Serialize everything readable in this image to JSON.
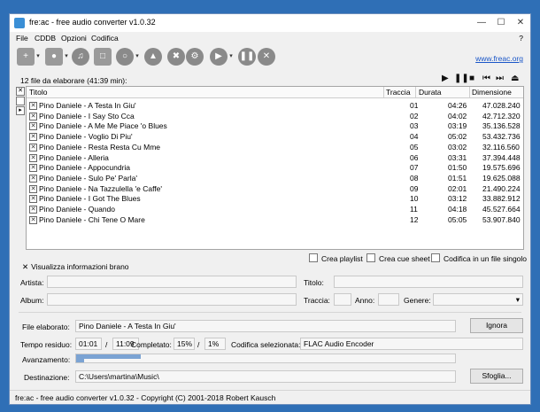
{
  "window": {
    "title": "fre:ac - free audio converter v1.0.32"
  },
  "menu": {
    "items": [
      "File",
      "CDDB",
      "Opzioni",
      "Codifica"
    ],
    "help": "?"
  },
  "toolbar": {
    "link": "www.freac.org"
  },
  "list": {
    "file_count": "12 file da elaborare (41:39 min):",
    "columns": {
      "title": "Titolo",
      "track": "Traccia",
      "duration": "Durata",
      "size": "Dimensione"
    },
    "rows": [
      {
        "title": "Pino Daniele - A Testa In Giu'",
        "track": "01",
        "duration": "04:26",
        "size": "47.028.240"
      },
      {
        "title": "Pino Daniele - I Say Sto Cca",
        "track": "02",
        "duration": "04:02",
        "size": "42.712.320"
      },
      {
        "title": "Pino Daniele - A Me Me Piace 'o Blues",
        "track": "03",
        "duration": "03:19",
        "size": "35.136.528"
      },
      {
        "title": "Pino Daniele - Voglio Di Piu'",
        "track": "04",
        "duration": "05:02",
        "size": "53.432.736"
      },
      {
        "title": "Pino Daniele - Resta Resta Cu Mme",
        "track": "05",
        "duration": "03:02",
        "size": "32.116.560"
      },
      {
        "title": "Pino Daniele - Alleria",
        "track": "06",
        "duration": "03:31",
        "size": "37.394.448"
      },
      {
        "title": "Pino Daniele - Appocundria",
        "track": "07",
        "duration": "01:50",
        "size": "19.575.696"
      },
      {
        "title": "Pino Daniele - Sulo Pe' Parla'",
        "track": "08",
        "duration": "01:51",
        "size": "19.625.088"
      },
      {
        "title": "Pino Daniele - Na Tazzulella 'e Caffe'",
        "track": "09",
        "duration": "02:01",
        "size": "21.490.224"
      },
      {
        "title": "Pino Daniele - I Got The Blues",
        "track": "10",
        "duration": "03:12",
        "size": "33.882.912"
      },
      {
        "title": "Pino Daniele - Quando",
        "track": "11",
        "duration": "04:18",
        "size": "45.527.664"
      },
      {
        "title": "Pino Daniele - Chi Tene O Mare",
        "track": "12",
        "duration": "05:05",
        "size": "53.907.840"
      }
    ]
  },
  "options": {
    "playlist": "Crea playlist",
    "cue": "Crea cue sheet",
    "single": "Codifica in un file singolo"
  },
  "info": {
    "toggle": "Visualizza informazioni brano",
    "artist": "Artista:",
    "title": "Titolo:",
    "album": "Album:",
    "track": "Traccia:",
    "year": "Anno:",
    "genre": "Genere:"
  },
  "progress": {
    "file_label": "File elaborato:",
    "file_value": "Pino Daniele - A Testa In Giu'",
    "skip": "Ignora",
    "time_label": "Tempo residuo:",
    "time_value": "01:01",
    "slash": "/",
    "total_time": "11:09",
    "completed_label": "Completato:",
    "percent_file": "15%",
    "percent_total": "1%",
    "codec_label": "Codifica selezionata:",
    "codec_value": "FLAC Audio Encoder",
    "advance_label": "Avanzamento:",
    "file_fraction": 0.17,
    "total_fraction": 0.02,
    "dest_label": "Destinazione:",
    "dest_value": "C:\\Users\\martina\\Music\\",
    "browse": "Sfoglia..."
  },
  "status": "fre:ac - free audio converter v1.0.32 - Copyright (C) 2001-2018 Robert Kausch"
}
